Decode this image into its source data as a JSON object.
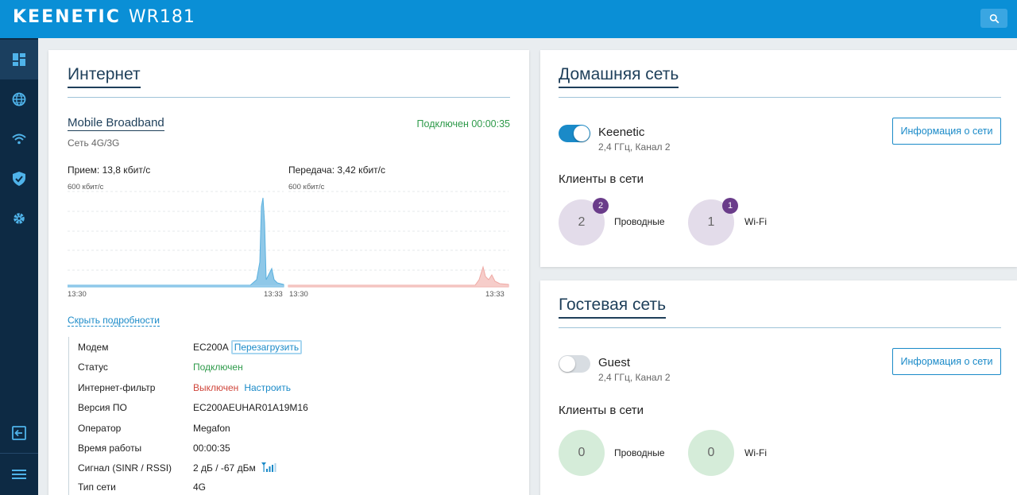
{
  "header": {
    "brand": "KEENETIC",
    "model": "WR181",
    "search_icon": "search-icon"
  },
  "sidebar": {
    "items": [
      {
        "icon": "dashboard-icon",
        "active": true
      },
      {
        "icon": "globe-icon",
        "active": false
      },
      {
        "icon": "wifi-icon",
        "active": false
      },
      {
        "icon": "shield-icon",
        "active": false
      },
      {
        "icon": "gear-icon",
        "active": false
      }
    ],
    "bottom_items": [
      {
        "icon": "logout-icon"
      },
      {
        "icon": "menu-icon"
      }
    ]
  },
  "internet": {
    "title": "Интернет",
    "connection": {
      "name": "Mobile Broadband",
      "type": "Сеть 4G/3G",
      "status": "Подключен 00:00:35"
    },
    "rx": {
      "label": "Прием: 13,8 кбит/с",
      "scale": "600 кбит/с",
      "x_start": "13:30",
      "x_end": "13:33",
      "color": "#7fc4e6"
    },
    "tx": {
      "label": "Передача: 3,42 кбит/с",
      "scale": "600 кбит/с",
      "x_start": "13:30",
      "x_end": "13:33",
      "color": "#f3b7b3"
    },
    "hide_details_link": "Скрыть подробности",
    "details": {
      "modem_label": "Модем",
      "modem_value": "EC200A",
      "modem_reboot": "Перезагрузить",
      "status_label": "Статус",
      "status_value": "Подключен",
      "filter_label": "Интернет-фильтр",
      "filter_value": "Выключен",
      "filter_config": "Настроить",
      "firmware_label": "Версия ПО",
      "firmware_value": "EC200AEUHAR01A19M16",
      "operator_label": "Оператор",
      "operator_value": "Megafon",
      "uptime_label": "Время работы",
      "uptime_value": "00:00:35",
      "signal_label": "Сигнал (SINR / RSSI)",
      "signal_value": "2 дБ / -67 дБм",
      "nettype_label": "Тип сети",
      "nettype_value": "4G"
    }
  },
  "home_network": {
    "title": "Домашняя сеть",
    "ssid": "Keenetic",
    "band": "2,4 ГГц, Канал 2",
    "enabled": true,
    "info_button": "Информация о сети",
    "clients_title": "Клиенты в сети",
    "wired_count": "2",
    "wired_badge": "2",
    "wired_label": "Проводные",
    "wifi_count": "1",
    "wifi_badge": "1",
    "wifi_label": "Wi-Fi"
  },
  "guest_network": {
    "title": "Гостевая сеть",
    "ssid": "Guest",
    "band": "2,4 ГГц, Канал 2",
    "enabled": false,
    "info_button": "Информация о сети",
    "clients_title": "Клиенты в сети",
    "wired_count": "0",
    "wired_label": "Проводные",
    "wifi_count": "0",
    "wifi_label": "Wi-Fi"
  }
}
